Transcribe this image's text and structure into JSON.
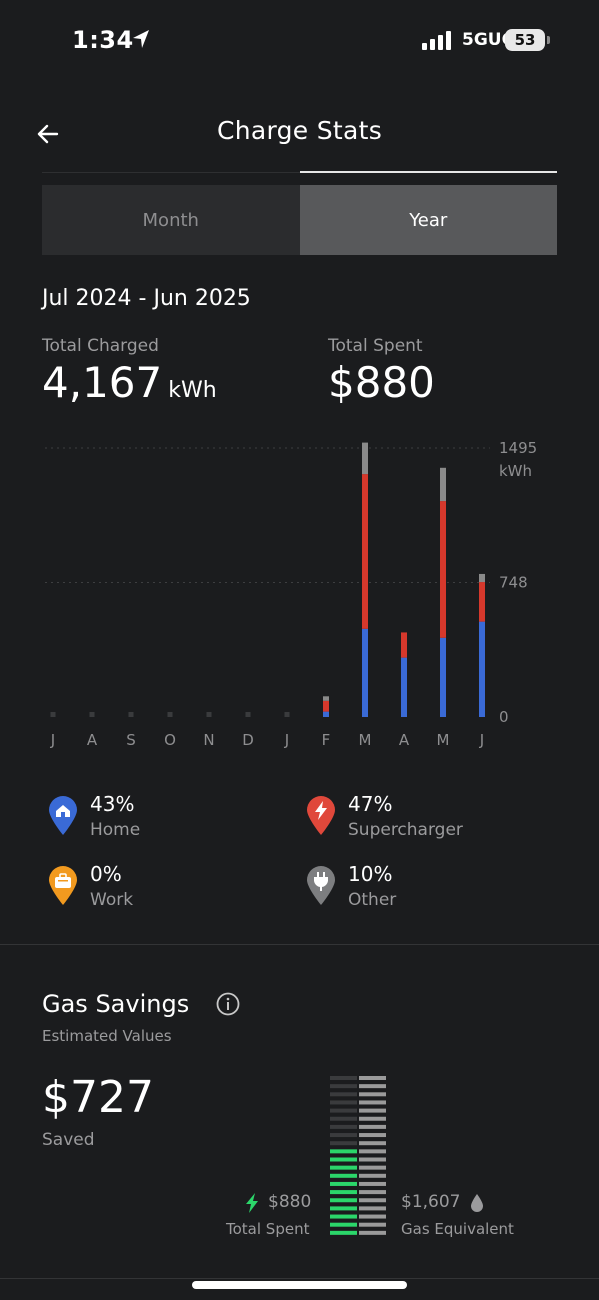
{
  "status_bar": {
    "time": "1:34",
    "network": "5GUC",
    "battery": "53"
  },
  "header": {
    "title": "Charge Stats",
    "back_icon": "arrow-left-icon"
  },
  "tabs": [
    {
      "label": "Month",
      "active": false
    },
    {
      "label": "Year",
      "active": true
    }
  ],
  "period": "Jul 2024 - Jun 2025",
  "totals": {
    "charged_label": "Total Charged",
    "charged_value": "4,167",
    "charged_unit": "kWh",
    "spent_label": "Total Spent",
    "spent_value": "$880"
  },
  "chart_data": {
    "type": "bar",
    "stacked": true,
    "categories": [
      "J",
      "A",
      "S",
      "O",
      "N",
      "D",
      "J",
      "F",
      "M",
      "A",
      "M",
      "J"
    ],
    "series": [
      {
        "name": "Home",
        "color": "#3a6ad6",
        "values": [
          0,
          0,
          0,
          0,
          0,
          0,
          0,
          30,
          490,
          330,
          440,
          530
        ]
      },
      {
        "name": "Supercharger",
        "color": "#d6382c",
        "values": [
          0,
          0,
          0,
          0,
          0,
          0,
          0,
          60,
          860,
          140,
          760,
          220
        ]
      },
      {
        "name": "Other",
        "color": "#8a8a8a",
        "values": [
          0,
          0,
          0,
          0,
          0,
          0,
          0,
          25,
          175,
          0,
          185,
          45
        ]
      }
    ],
    "yticks": [
      "0",
      "748",
      "1495"
    ],
    "y_unit": "kWh",
    "ylim": [
      0,
      1495
    ],
    "grid": true
  },
  "legend": [
    {
      "pct": "43%",
      "name": "Home",
      "color": "#3a6ad6",
      "icon": "home-icon"
    },
    {
      "pct": "47%",
      "name": "Supercharger",
      "color": "#e0483b",
      "icon": "bolt-icon"
    },
    {
      "pct": "0%",
      "name": "Work",
      "color": "#f29a1f",
      "icon": "briefcase-icon"
    },
    {
      "pct": "10%",
      "name": "Other",
      "color": "#7d7e80",
      "icon": "plug-icon"
    }
  ],
  "gas_savings": {
    "title": "Gas Savings",
    "subtitle": "Estimated Values",
    "saved_value": "$727",
    "saved_label": "Saved",
    "spent_value": "$880",
    "spent_label": "Total Spent",
    "gas_value": "$1,607",
    "gas_label": "Gas Equivalent",
    "spent_color": "#2bd66a",
    "spent_fraction": 0.55
  }
}
